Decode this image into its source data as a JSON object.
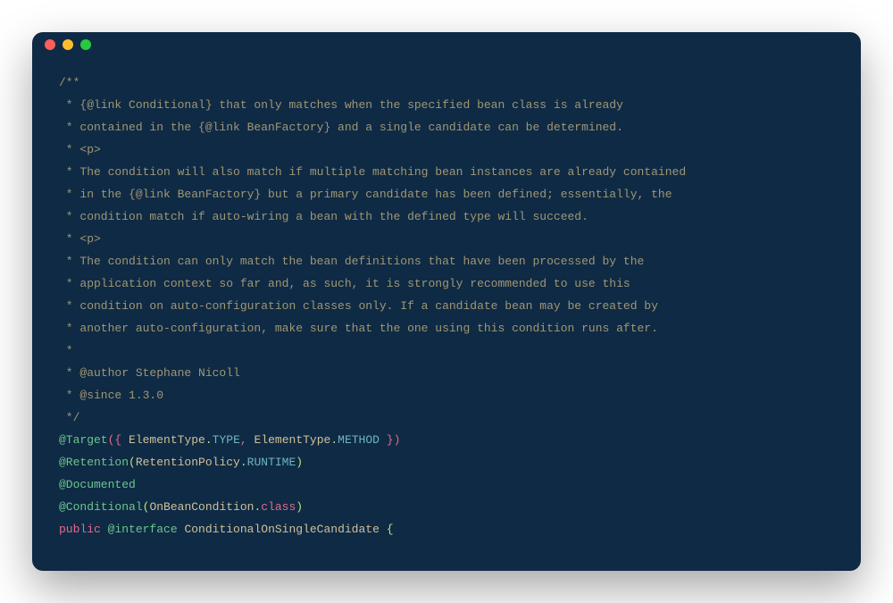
{
  "window_controls": {
    "close": "close",
    "minimize": "minimize",
    "zoom": "zoom"
  },
  "code": {
    "c1": "/**",
    "c2": " * {@link Conditional} that only matches when the specified bean class is already",
    "c3": " * contained in the {@link BeanFactory} and a single candidate can be determined.",
    "c4": " * <p>",
    "c5": " * The condition will also match if multiple matching bean instances are already contained",
    "c6": " * in the {@link BeanFactory} but a primary candidate has been defined; essentially, the",
    "c7": " * condition match if auto-wiring a bean with the defined type will succeed.",
    "c8": " * <p>",
    "c9": " * The condition can only match the bean definitions that have been processed by the",
    "c10": " * application context so far and, as such, it is strongly recommended to use this",
    "c11": " * condition on auto-configuration classes only. If a candidate bean may be created by",
    "c12": " * another auto-configuration, make sure that the one using this condition runs after.",
    "c13": " *",
    "c14": " * @author Stephane Nicoll",
    "c15": " * @since 1.3.0",
    "c16": " */",
    "l1": {
      "a1": "@Target",
      "p1": "({",
      "sp1": " ",
      "cls1": "ElementType",
      "dot1": ".",
      "m1": "TYPE",
      "comma": ",",
      "sp2": " ",
      "cls2": "ElementType",
      "dot2": ".",
      "m2": "METHOD",
      "sp3": " ",
      "p2": "})"
    },
    "l2": {
      "a1": "@Retention",
      "p1": "(",
      "cls1": "RetentionPolicy",
      "dot1": ".",
      "m1": "RUNTIME",
      "p2": ")"
    },
    "l3": {
      "a1": "@Documented"
    },
    "l4": {
      "a1": "@Conditional",
      "p1": "(",
      "cls1": "OnBeanCondition",
      "dot1": ".",
      "m1": "class",
      "p2": ")"
    },
    "l5": {
      "k1": "public",
      "sp1": " ",
      "k2": "@interface",
      "sp2": " ",
      "cls1": "ConditionalOnSingleCandidate",
      "sp3": " ",
      "brace": "{"
    }
  }
}
